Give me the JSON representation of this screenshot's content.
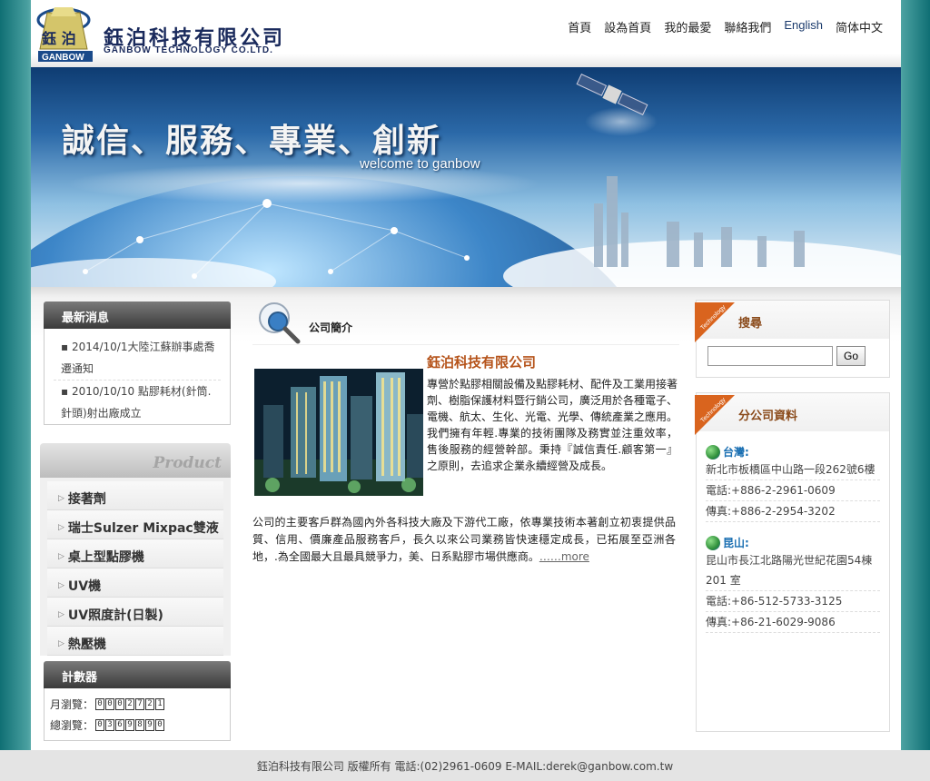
{
  "header": {
    "logo_cn": "鈺泊科技有限公司",
    "logo_en": "GANBOW TECHNOLOGY CO.LTD.",
    "logo_badge_chars": "鈺 泊",
    "logo_badge_text": "GANBOW",
    "nav": [
      "首頁",
      "設為首頁",
      "我的最愛",
      "聯絡我們",
      "English",
      "简体中文"
    ]
  },
  "banner": {
    "slogan": "誠信、服務、專業、創新",
    "welcome": "welcome to ganbow"
  },
  "news": {
    "title": "最新消息",
    "items": [
      "2014/10/1大陸江蘇辦事處喬遷通知",
      "2010/10/10 點膠耗材(針筒.針頭)射出廠成立"
    ]
  },
  "product": {
    "title": "Product",
    "items": [
      "接著劑",
      "瑞士Sulzer Mixpac雙液",
      "桌上型點膠機",
      "UV機",
      "UV照度計(日製)",
      "熱壓機"
    ]
  },
  "counter": {
    "title": "計數器",
    "monthly_label": "月瀏覽：",
    "monthly_digits": [
      "0",
      "0",
      "0",
      "2",
      "7",
      "2",
      "1"
    ],
    "total_label": "總瀏覽：",
    "total_digits": [
      "0",
      "3",
      "6",
      "9",
      "8",
      "9",
      "0"
    ]
  },
  "intro": {
    "section_title": "公司簡介",
    "company_name": "鈺泊科技有限公司",
    "para1": "專營於點膠相關設備及點膠耗材、配件及工業用接著劑、樹脂保護材料暨行銷公司，廣泛用於各種電子、電機、航太、生化、光電、光學、傳統產業之應用。我們擁有年輕.專業的技術團隊及務實並注重效率，售後服務的經營幹部。秉持『誠信責任.顧客第一』之原則，去追求企業永續經營及成長。",
    "para2": "公司的主要客戶群為國內外各科技大廠及下游代工廠，依專業技術本著創立初衷提供品質、信用、價廉產品服務客戶，長久以來公司業務皆快速穩定成長，已拓展至亞洲各地，.為全國最大且最具競爭力，美、日系點膠市場供應商。",
    "more": "……more"
  },
  "search": {
    "title": "搜尋",
    "button": "Go",
    "placeholder": "",
    "tag_text": "Technology"
  },
  "branches": {
    "title": "分公司資料",
    "list": [
      {
        "name": "台灣:",
        "address": "新北市板橋區中山路一段262號6樓",
        "tel": "電話:+886-2-2961-0609",
        "fax": "傳真:+886-2-2954-3202"
      },
      {
        "name": "昆山:",
        "address": "昆山市長江北路陽光世紀花園54棟201 室",
        "tel": "電話:+86-512-5733-3125",
        "fax": "傳真:+86-21-6029-9086"
      }
    ]
  },
  "footer": {
    "text": "鈺泊科技有限公司 版權所有  電話:(02)2961-0609  E-MAIL:derek@ganbow.com.tw"
  }
}
